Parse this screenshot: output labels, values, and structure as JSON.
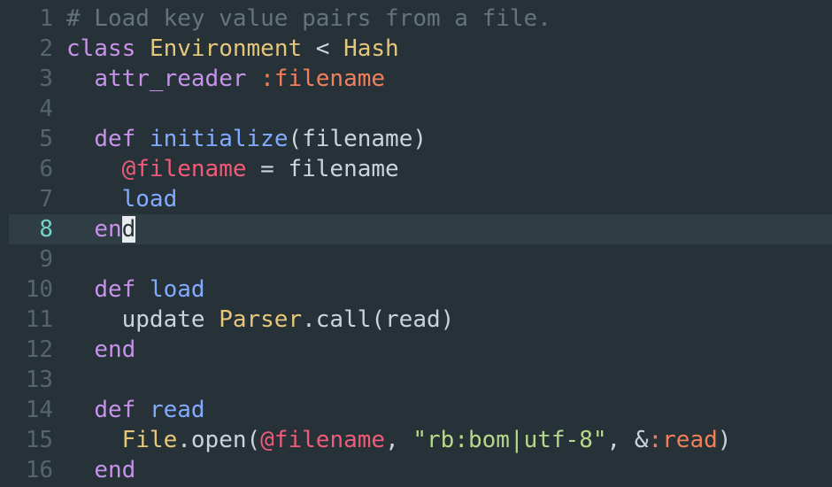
{
  "editor": {
    "active_line": 8,
    "colors": {
      "background": "#263238",
      "active_line_background": "#2f3d44",
      "gutter": "#56656d",
      "gutter_active": "#74d3c7",
      "comment": "#65737e",
      "keyword": "#c792ea",
      "class": "#e6c77a",
      "plain": "#cdd3de",
      "method": "#82aaff",
      "symbol": "#f07f5a",
      "instance_variable": "#ef5b78",
      "string": "#b5d98a"
    },
    "lines": [
      {
        "number": "1",
        "tokens": [
          {
            "t": "comment",
            "v": "# Load key value pairs from a file."
          }
        ]
      },
      {
        "number": "2",
        "tokens": [
          {
            "t": "keyword",
            "v": "class"
          },
          {
            "t": "plain",
            "v": " "
          },
          {
            "t": "class",
            "v": "Environment"
          },
          {
            "t": "plain",
            "v": " < "
          },
          {
            "t": "class",
            "v": "Hash"
          }
        ]
      },
      {
        "number": "3",
        "tokens": [
          {
            "t": "plain",
            "v": "  "
          },
          {
            "t": "keyword",
            "v": "attr_reader"
          },
          {
            "t": "plain",
            "v": " "
          },
          {
            "t": "symbol",
            "v": ":filename"
          }
        ]
      },
      {
        "number": "4",
        "tokens": []
      },
      {
        "number": "5",
        "tokens": [
          {
            "t": "plain",
            "v": "  "
          },
          {
            "t": "keyword",
            "v": "def"
          },
          {
            "t": "plain",
            "v": " "
          },
          {
            "t": "method",
            "v": "initialize"
          },
          {
            "t": "plain",
            "v": "(filename)"
          }
        ]
      },
      {
        "number": "6",
        "tokens": [
          {
            "t": "plain",
            "v": "    "
          },
          {
            "t": "ivar",
            "v": "@filename"
          },
          {
            "t": "plain",
            "v": " = filename"
          }
        ]
      },
      {
        "number": "7",
        "tokens": [
          {
            "t": "plain",
            "v": "    "
          },
          {
            "t": "method",
            "v": "load"
          }
        ]
      },
      {
        "number": "8",
        "tokens": [
          {
            "t": "plain",
            "v": "  "
          },
          {
            "t": "keyword",
            "v": "en"
          },
          {
            "t": "cursor",
            "v": "d"
          }
        ]
      },
      {
        "number": "9",
        "tokens": []
      },
      {
        "number": "10",
        "tokens": [
          {
            "t": "plain",
            "v": "  "
          },
          {
            "t": "keyword",
            "v": "def"
          },
          {
            "t": "plain",
            "v": " "
          },
          {
            "t": "method",
            "v": "load"
          }
        ]
      },
      {
        "number": "11",
        "tokens": [
          {
            "t": "plain",
            "v": "    update "
          },
          {
            "t": "class",
            "v": "Parser"
          },
          {
            "t": "plain",
            "v": ".call(read)"
          }
        ]
      },
      {
        "number": "12",
        "tokens": [
          {
            "t": "plain",
            "v": "  "
          },
          {
            "t": "keyword",
            "v": "end"
          }
        ]
      },
      {
        "number": "13",
        "tokens": []
      },
      {
        "number": "14",
        "tokens": [
          {
            "t": "plain",
            "v": "  "
          },
          {
            "t": "keyword",
            "v": "def"
          },
          {
            "t": "plain",
            "v": " "
          },
          {
            "t": "method",
            "v": "read"
          }
        ]
      },
      {
        "number": "15",
        "tokens": [
          {
            "t": "plain",
            "v": "    "
          },
          {
            "t": "class",
            "v": "File"
          },
          {
            "t": "plain",
            "v": ".open("
          },
          {
            "t": "ivar",
            "v": "@filename"
          },
          {
            "t": "plain",
            "v": ", "
          },
          {
            "t": "string",
            "v": "\"rb:bom|utf-8\""
          },
          {
            "t": "plain",
            "v": ", &"
          },
          {
            "t": "symbol",
            "v": ":read"
          },
          {
            "t": "plain",
            "v": ")"
          }
        ]
      },
      {
        "number": "16",
        "tokens": [
          {
            "t": "plain",
            "v": "  "
          },
          {
            "t": "keyword",
            "v": "end"
          }
        ]
      }
    ]
  }
}
